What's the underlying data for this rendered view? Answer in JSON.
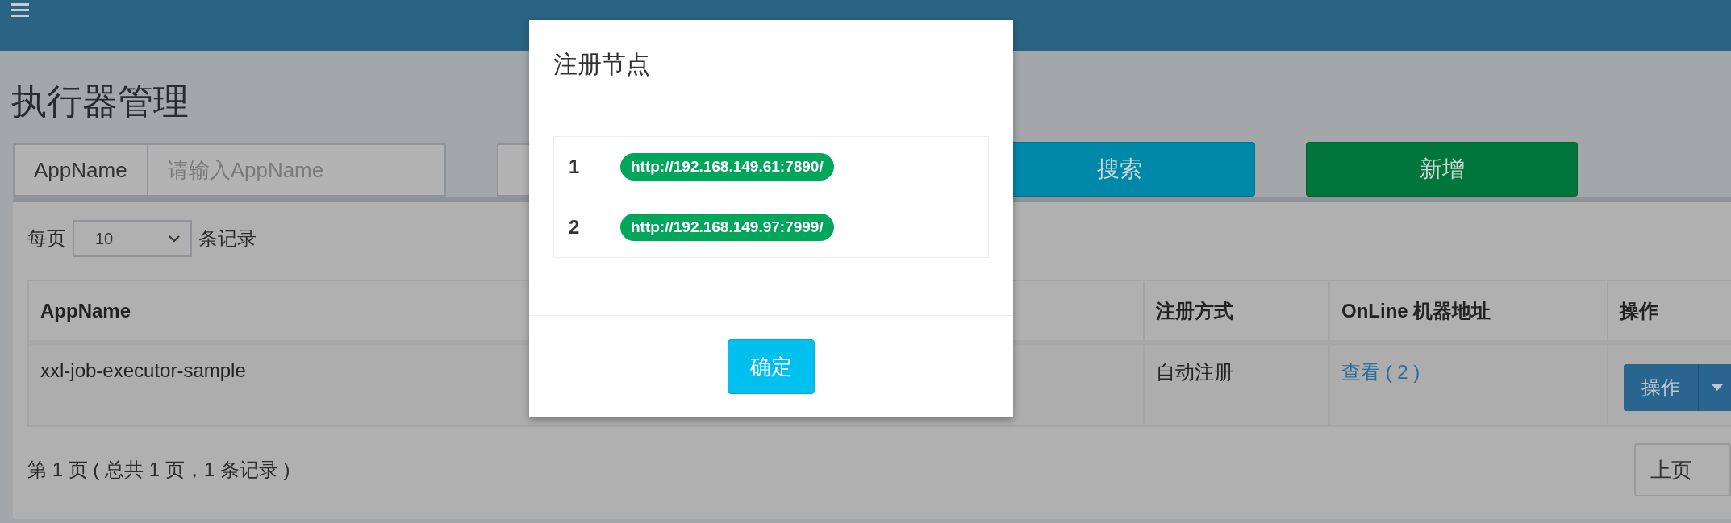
{
  "page_title": "执行器管理",
  "filters": [
    {
      "label": "AppName",
      "placeholder": "请输入AppName"
    }
  ],
  "buttons": [
    {
      "kind": "search",
      "label": "搜索"
    },
    {
      "kind": "add",
      "label": "新增"
    }
  ],
  "page_size": {
    "prefix": "每页",
    "value": "10",
    "suffix": "条记录"
  },
  "table": {
    "columns": [
      "AppName",
      "注册方式",
      "OnLine 机器地址",
      "操作"
    ],
    "rows": [
      {
        "app_name": "xxl-job-executor-sample",
        "registry_type": "自动注册",
        "online": "查看 ( 2 )",
        "action": "操作"
      }
    ]
  },
  "pagination": {
    "summary": "第 1 页 ( 总共 1 页，1 条记录 )",
    "prev": "上页"
  },
  "modal": {
    "title": "注册节点",
    "nodes": [
      {
        "index": "1",
        "address": "http://192.168.149.61:7890/"
      },
      {
        "index": "2",
        "address": "http://192.168.149.97:7999/"
      }
    ],
    "confirm": "确定"
  }
}
